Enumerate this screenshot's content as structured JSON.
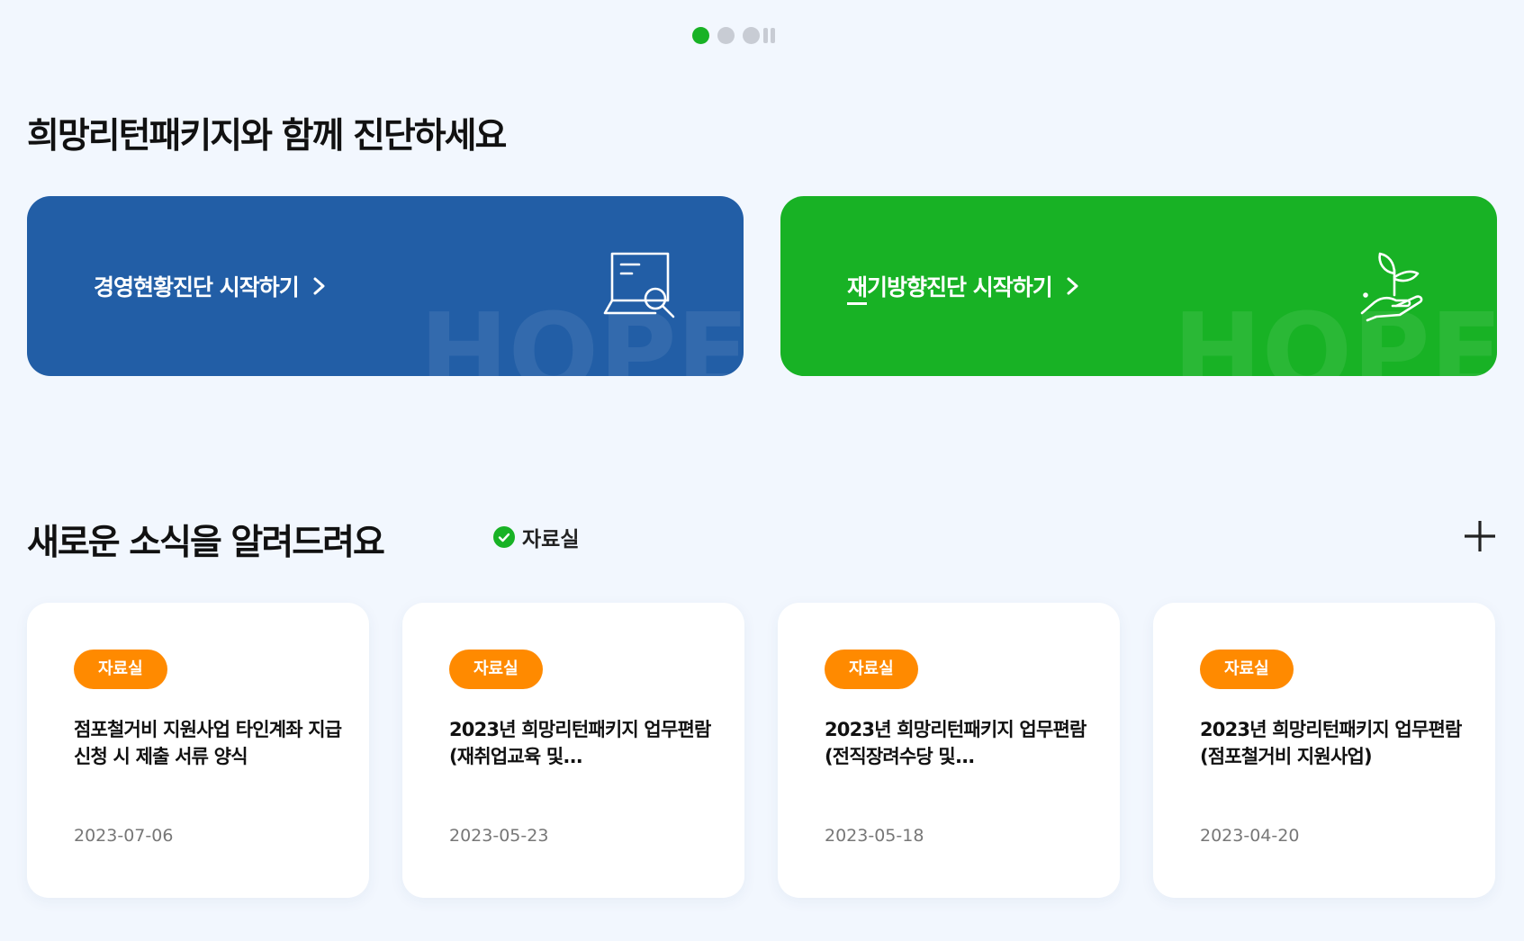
{
  "carousel": {
    "slides": 3,
    "active": 0
  },
  "section1": {
    "title": "희망리턴패키지와 함께 진단하세요"
  },
  "banners": [
    {
      "label": "경영현황진단 시작하기",
      "color": "#225ea6",
      "watermark": "HOPE",
      "icon": "document-search-icon"
    },
    {
      "label": "재기방향진단 시작하기",
      "color": "#18b225",
      "watermark": "HOPE",
      "icon": "hand-sprout-icon"
    }
  ],
  "section2": {
    "title": "새로운 소식을 알려드려요",
    "filter_label": "자료실"
  },
  "colors": {
    "accent_green": "#18b225",
    "accent_blue": "#225ea6",
    "badge_orange": "#ff8a00"
  },
  "cards": [
    {
      "badge": "자료실",
      "title": "점포철거비 지원사업 타인계좌 지급 신청 시 제출 서류 양식",
      "date": "2023-07-06"
    },
    {
      "badge": "자료실",
      "title": "2023년 희망리턴패키지 업무편람(재취업교육 및...",
      "date": "2023-05-23"
    },
    {
      "badge": "자료실",
      "title": "2023년 희망리턴패키지 업무편람(전직장려수당 및...",
      "date": "2023-05-18"
    },
    {
      "badge": "자료실",
      "title": "2023년 희망리턴패키지 업무편람(점포철거비 지원사업)",
      "date": "2023-04-20"
    }
  ]
}
